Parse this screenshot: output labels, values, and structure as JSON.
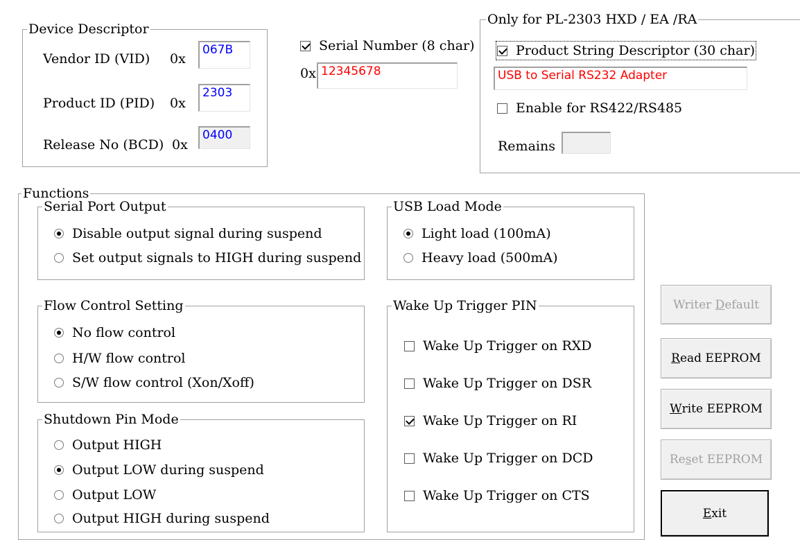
{
  "device_descriptor": {
    "title": "Device Descriptor",
    "vid_label": "Vendor ID (VID)",
    "pid_label": "Product ID (PID)",
    "release_label": "Release No (BCD)",
    "hex_prefix": "0x",
    "vid_value": "067B",
    "pid_value": "2303",
    "release_value": "0400"
  },
  "serial": {
    "checkbox_label": "Serial Number (8 char)",
    "checked": true,
    "hex_prefix": "0x",
    "value": "12345678"
  },
  "pl2303": {
    "title": "Only for PL-2303 HXD / EA /RA",
    "product_string_label": "Product String Descriptor (30 char)",
    "product_string_checked": true,
    "product_string_value": "USB to Serial RS232 Adapter",
    "rs422_label": "Enable for RS422/RS485",
    "rs422_checked": false,
    "remains_label": "Remains",
    "remains_value": ""
  },
  "functions": {
    "title": "Functions",
    "serial_port_output": {
      "title": "Serial Port Output",
      "options": [
        "Disable output signal during suspend",
        "Set output signals to HIGH during suspend"
      ],
      "selected": 0
    },
    "usb_load_mode": {
      "title": "USB Load Mode",
      "options": [
        "Light load (100mA)",
        "Heavy load (500mA)"
      ],
      "selected": 0
    },
    "flow_control": {
      "title": "Flow Control Setting",
      "options": [
        "No flow control",
        "H/W flow control",
        "S/W flow control (Xon/Xoff)"
      ],
      "selected": 0
    },
    "wake_up": {
      "title": "Wake Up Trigger PIN",
      "items": [
        {
          "label": "Wake Up Trigger on RXD",
          "checked": false
        },
        {
          "label": "Wake Up Trigger on DSR",
          "checked": false
        },
        {
          "label": "Wake Up Trigger on RI",
          "checked": true
        },
        {
          "label": "Wake Up Trigger on DCD",
          "checked": false
        },
        {
          "label": "Wake Up Trigger on CTS",
          "checked": false
        }
      ]
    },
    "shutdown_pin": {
      "title": "Shutdown Pin Mode",
      "options": [
        "Output HIGH",
        "Output LOW during suspend",
        "Output LOW",
        "Output HIGH during suspend"
      ],
      "selected": 1
    }
  },
  "buttons": {
    "writer_default": {
      "pre": "Writer ",
      "acc": "D",
      "post": "efault",
      "enabled": false
    },
    "read_eeprom": {
      "pre": "",
      "acc": "R",
      "post": "ead EEPROM",
      "enabled": true
    },
    "write_eeprom": {
      "pre": "",
      "acc": "W",
      "post": "rite EEPROM",
      "enabled": true
    },
    "reset_eeprom": {
      "pre": "Re",
      "acc": "s",
      "post": "et EEPROM",
      "enabled": false
    },
    "exit": {
      "pre": "",
      "acc": "E",
      "post": "xit",
      "enabled": true
    }
  },
  "colors": {
    "value_blue": "#0000ff",
    "value_red": "#ff0000",
    "group_border": "#a0a0a0",
    "disabled_text": "#a0a0a0"
  }
}
